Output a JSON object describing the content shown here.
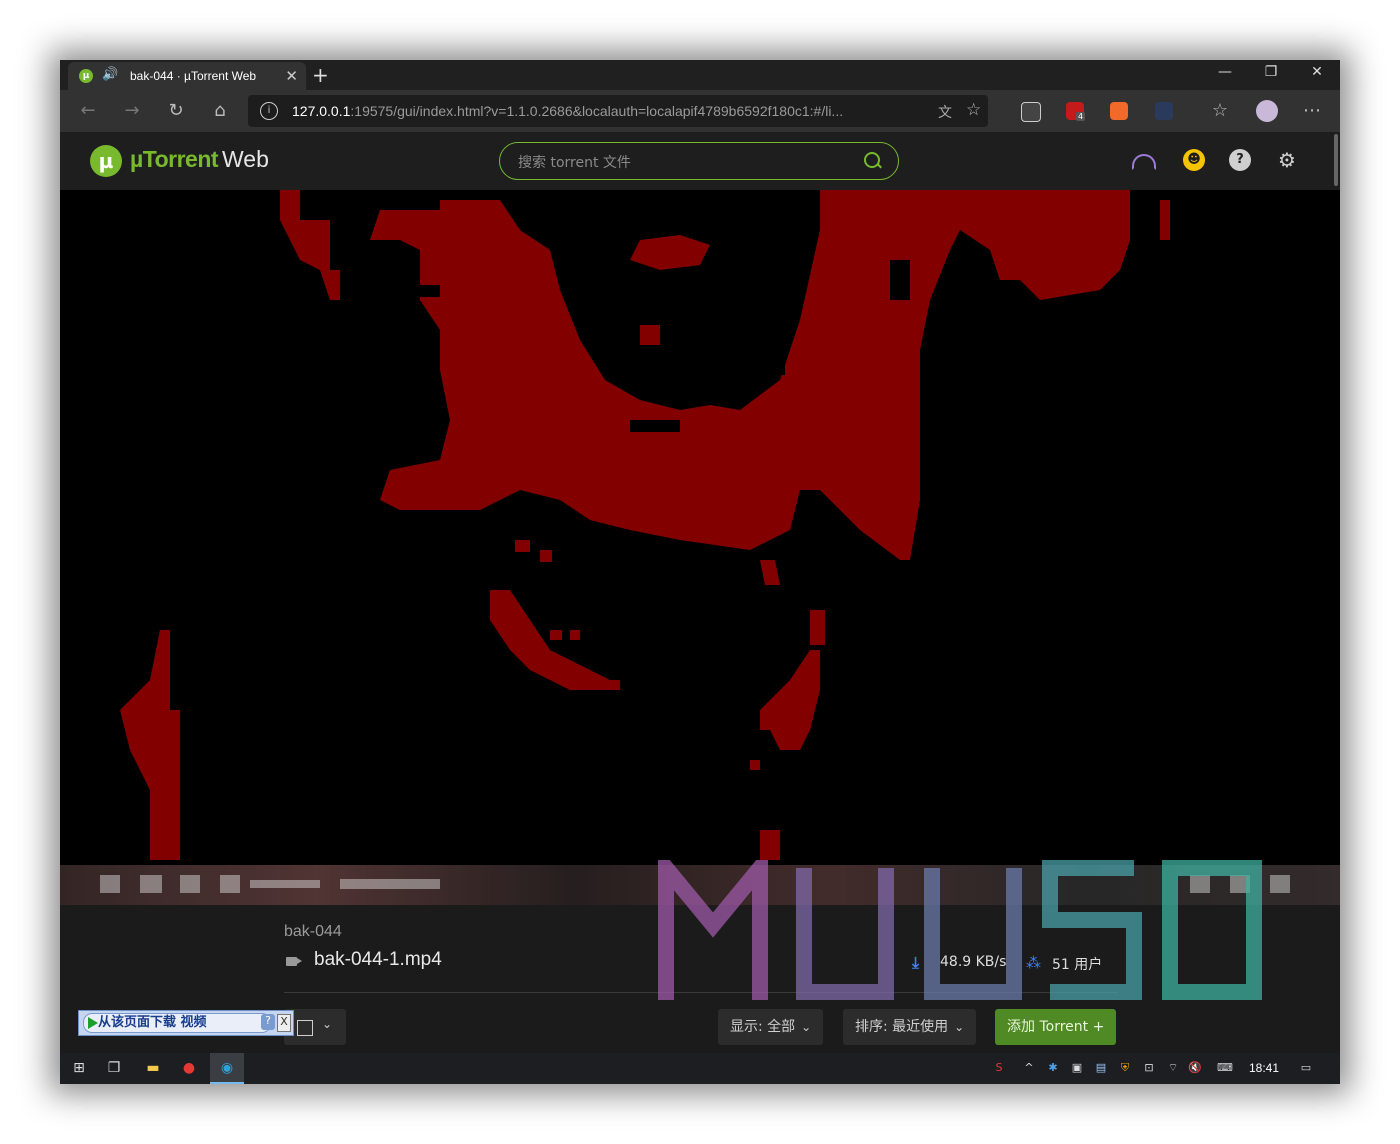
{
  "browser": {
    "tab_title": "bak-044 · µTorrent Web",
    "url_host": "127.0.0.1",
    "url_rest": ":19575/gui/index.html?v=1.1.0.2686&localauth=localapif4789b6592f180c1:#/li...",
    "ext_abp_badge": "4",
    "icons": [
      "back-icon",
      "forward-icon",
      "refresh-icon",
      "home-icon",
      "info-icon",
      "translate-icon",
      "star-icon",
      "favorites-icon",
      "profile-avatar",
      "more-icon"
    ]
  },
  "app": {
    "brand_green": "µTorrent",
    "brand_white": "Web",
    "search_placeholder": "搜索 torrent 文件",
    "accent": "#78b92e",
    "header_icons": [
      "speed-gauge-icon",
      "upgrade-pro-icon",
      "help-icon",
      "settings-icon"
    ],
    "help_glyph": "?"
  },
  "player": {
    "torrent_name": "bak-044",
    "file_name": "bak-044-1.mp4",
    "download_speed": "48.9 KB/s",
    "peers": "51 用户"
  },
  "toolbar": {
    "display_label": "显示: 全部",
    "sort_label": "排序: 最近使用",
    "add_label": "添加 Torrent +"
  },
  "download_helper": {
    "label": "从该页面下载 视频",
    "help": "?",
    "close": "X"
  },
  "watermark_text": "MUUSO",
  "taskbar": {
    "time": "18:41",
    "pinned": [
      "windows-start-icon",
      "task-view-icon",
      "file-explorer-icon",
      "netease-music-icon",
      "edge-beta-icon"
    ]
  }
}
